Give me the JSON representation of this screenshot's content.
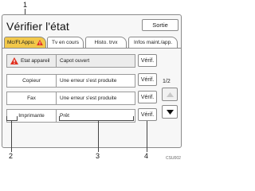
{
  "callouts": {
    "c1": "1",
    "c2": "2",
    "c3": "3",
    "c4": "4"
  },
  "screen": {
    "title": "Vérifier l'état",
    "exit_label": "Sortie",
    "tabs": [
      {
        "label": "Mc/Ft.Appu.",
        "active": true,
        "has_warning": true
      },
      {
        "label": "Tv en cours",
        "active": false
      },
      {
        "label": "Histo. trvx",
        "active": false
      },
      {
        "label": "Infos maint./app.",
        "active": false
      }
    ],
    "header_row": {
      "device": "Etat appareil",
      "status": "Capot ouvert",
      "check": "Vérif."
    },
    "rows": [
      {
        "device": "Copieur",
        "status": "Une erreur s'est produite",
        "check": "Vérif."
      },
      {
        "device": "Fax",
        "status": "Une erreur s'est produite",
        "check": "Vérif."
      },
      {
        "device": "Imprimante",
        "status": "Prêt",
        "check": "Vérif."
      }
    ],
    "page_indicator": "1/2",
    "colors": {
      "active_tab": "#f2c84a",
      "warning": "#e03020"
    }
  },
  "figure_code": "CSU002"
}
